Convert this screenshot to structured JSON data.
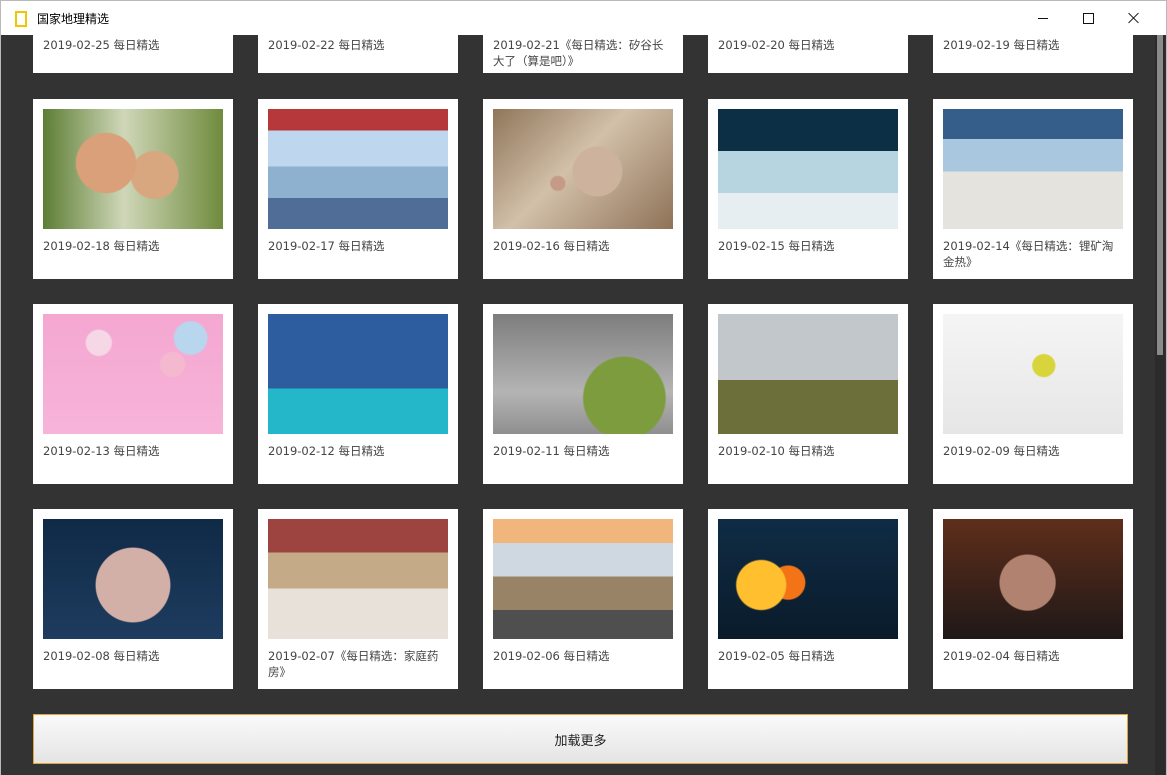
{
  "window": {
    "title": "国家地理精选",
    "controls": {
      "minimize_icon": "minimize-icon",
      "maximize_icon": "maximize-icon",
      "close_icon": "close-icon"
    }
  },
  "gallery": {
    "top_row": [
      {
        "caption": "2019-02-25 每日精选"
      },
      {
        "caption": "2019-02-22 每日精选"
      },
      {
        "caption": "2019-02-21《每日精选：矽谷长大了（算是吧）》"
      },
      {
        "caption": "2019-02-20 每日精选"
      },
      {
        "caption": "2019-02-19 每日精选"
      }
    ],
    "rows": [
      [
        {
          "caption": "2019-02-18 每日精选",
          "image_name": "father-child-photo"
        },
        {
          "caption": "2019-02-17 每日精选",
          "image_name": "boat-lake-photo"
        },
        {
          "caption": "2019-02-16 每日精选",
          "image_name": "fox-photo"
        },
        {
          "caption": "2019-02-15 每日精选",
          "image_name": "ice-cave-photo"
        },
        {
          "caption": "2019-02-14《每日精选：锂矿淘金热》",
          "image_name": "salt-workers-photo"
        }
      ],
      [
        {
          "caption": "2019-02-13 每日精选",
          "image_name": "balloons-photo"
        },
        {
          "caption": "2019-02-12 每日精选",
          "image_name": "swimmers-photo"
        },
        {
          "caption": "2019-02-11 每日精选",
          "image_name": "goat-rock-photo"
        },
        {
          "caption": "2019-02-10 每日精选",
          "image_name": "giraffes-photo"
        },
        {
          "caption": "2019-02-09 每日精选",
          "image_name": "bird-blossom-photo"
        }
      ],
      [
        {
          "caption": "2019-02-08 每日精选",
          "image_name": "woman-portrait-photo"
        },
        {
          "caption": "2019-02-07《每日精选：家庭药房》",
          "image_name": "family-books-photo"
        },
        {
          "caption": "2019-02-06 每日精选",
          "image_name": "sheep-road-photo"
        },
        {
          "caption": "2019-02-05 每日精选",
          "image_name": "fire-breather-photo"
        },
        {
          "caption": "2019-02-04 每日精选",
          "image_name": "boxer-photo"
        }
      ]
    ]
  },
  "load_more": {
    "label": "加载更多"
  },
  "colors": {
    "window_bg": "#333333",
    "card_bg": "#ffffff",
    "accent": "#e0a53a"
  }
}
